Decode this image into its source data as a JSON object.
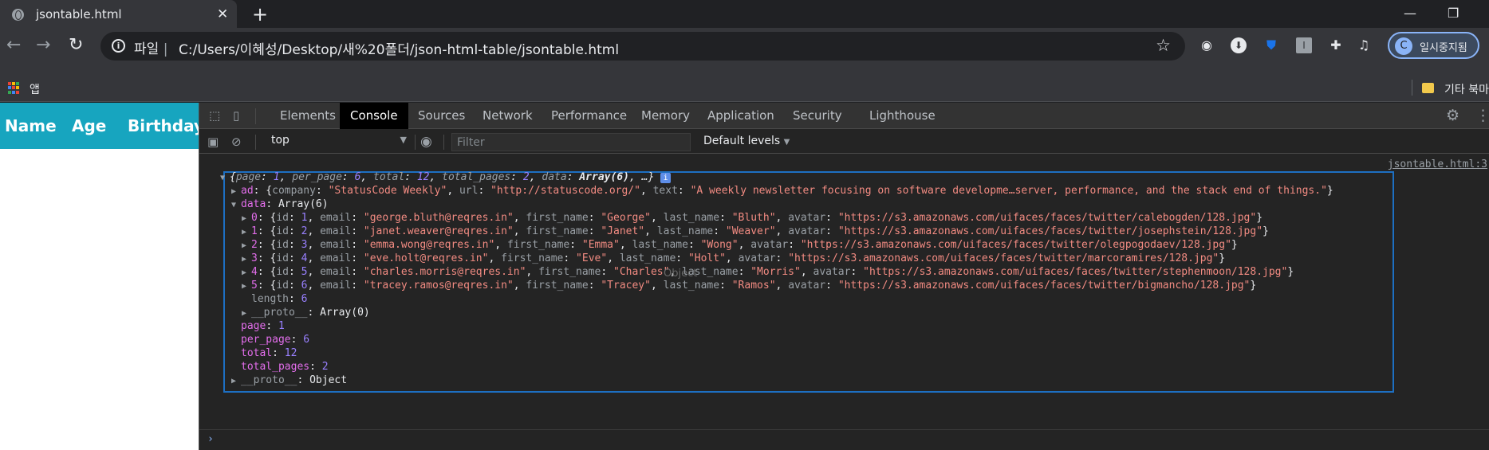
{
  "browser": {
    "tab_title": "jsontable.html",
    "scheme_label": "파일",
    "url": "C:/Users/이혜성/Desktop/새%20폴더/json-html-table/jsontable.html",
    "profile_initial": "C",
    "profile_label": "일시중지됨",
    "bookmarks": {
      "apps": "앱",
      "other": "기타 북마"
    }
  },
  "page": {
    "table_headers": [
      "Name",
      "Age",
      "Birthday"
    ],
    "header_color": "#17a5bf"
  },
  "devtools": {
    "tabs": [
      "Elements",
      "Console",
      "Sources",
      "Network",
      "Performance",
      "Memory",
      "Application",
      "Security",
      "Lighthouse"
    ],
    "active_tab": "Console",
    "context": "top",
    "filter_placeholder": "Filter",
    "levels": "Default levels",
    "source_link": "jsontable.html:3",
    "hover_tooltip": "Object"
  },
  "console": {
    "summary": {
      "page": "1",
      "per_page": "6",
      "total": "12",
      "total_pages": "2",
      "data_type": "Array(6)"
    },
    "ad": {
      "company": "\"StatusCode Weekly\"",
      "url": "\"http://statuscode.org/\"",
      "text": "\"A weekly newsletter focusing on software developme…server, performance, and the stack end of things.\""
    },
    "data_label": "Array(6)",
    "rows": [
      {
        "idx": "0",
        "id": "1",
        "email": "\"george.bluth@reqres.in\"",
        "first_name": "\"George\"",
        "last_name": "\"Bluth\"",
        "avatar": "\"https://s3.amazonaws.com/uifaces/faces/twitter/calebogden/128.jpg\""
      },
      {
        "idx": "1",
        "id": "2",
        "email": "\"janet.weaver@reqres.in\"",
        "first_name": "\"Janet\"",
        "last_name": "\"Weaver\"",
        "avatar": "\"https://s3.amazonaws.com/uifaces/faces/twitter/josephstein/128.jpg\""
      },
      {
        "idx": "2",
        "id": "3",
        "email": "\"emma.wong@reqres.in\"",
        "first_name": "\"Emma\"",
        "last_name": "\"Wong\"",
        "avatar": "\"https://s3.amazonaws.com/uifaces/faces/twitter/olegpogodaev/128.jpg\""
      },
      {
        "idx": "3",
        "id": "4",
        "email": "\"eve.holt@reqres.in\"",
        "first_name": "\"Eve\"",
        "last_name": "\"Holt\"",
        "avatar": "\"https://s3.amazonaws.com/uifaces/faces/twitter/marcoramires/128.jpg\""
      },
      {
        "idx": "4",
        "id": "5",
        "email": "\"charles.morris@reqres.in\"",
        "first_name": "\"Charles\"",
        "last_name": "\"Morris\"",
        "avatar": "\"https://s3.amazonaws.com/uifaces/faces/twitter/stephenmoon/128.jpg\""
      },
      {
        "idx": "5",
        "id": "6",
        "email": "\"tracey.ramos@reqres.in\"",
        "first_name": "\"Tracey\"",
        "last_name": "\"Ramos\"",
        "avatar": "\"https://s3.amazonaws.com/uifaces/faces/twitter/bigmancho/128.jpg\""
      }
    ],
    "length": "6",
    "data_proto": "Array(0)",
    "page": "1",
    "per_page": "6",
    "total": "12",
    "total_pages": "2",
    "proto": "Object"
  }
}
